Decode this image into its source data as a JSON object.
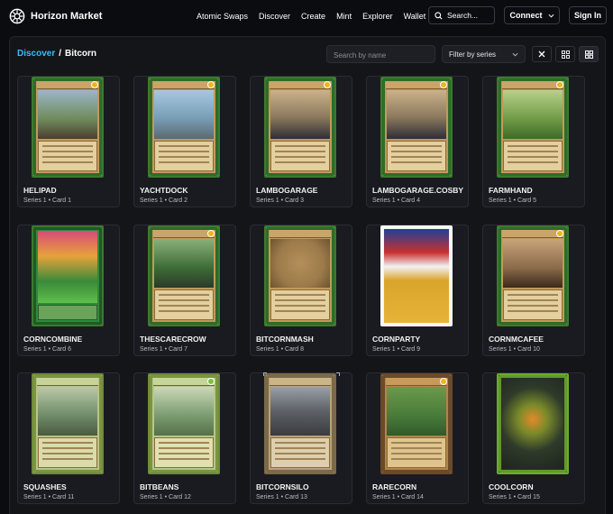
{
  "app": {
    "name": "Horizon Market"
  },
  "nav": {
    "items": [
      "Atomic Swaps",
      "Discover",
      "Create",
      "Mint",
      "Explorer",
      "Wallet"
    ]
  },
  "header": {
    "search_placeholder": "Search...",
    "connect_label": "Connect",
    "signin_label": "Sign In"
  },
  "breadcrumb": {
    "root": "Discover",
    "separator": "/",
    "current": "Bitcorn"
  },
  "filters": {
    "name_placeholder": "Search by name",
    "series_label": "Filter by series"
  },
  "icons": {
    "logo": "horizon-logo-icon",
    "search": "search-icon",
    "chevron": "chevron-down-icon",
    "clear": "close-icon",
    "grid_small": "small-grid-icon",
    "grid_large": "large-grid-icon"
  },
  "colors": {
    "accent": "#38bdf8",
    "background": "#0b0c10",
    "panel": "#141519",
    "card_border_green": "#3b7a2f"
  },
  "cards": [
    {
      "name": "HELIPAD",
      "subtitle": "Series 1 • Card 1",
      "art": "#6f8a5a"
    },
    {
      "name": "YACHTDOCK",
      "subtitle": "Series 1 • Card 2",
      "art": "#7aa0b8"
    },
    {
      "name": "LAMBOGARAGE",
      "subtitle": "Series 1 • Card 3",
      "art": "#8c7a5e"
    },
    {
      "name": "LAMBOGARAGE.COSBY",
      "subtitle": "Series 1 • Card 4",
      "art": "#8c7a5e"
    },
    {
      "name": "FARMHAND",
      "subtitle": "Series 1 • Card 5",
      "art": "#6f9a45"
    },
    {
      "name": "CORNCOMBINE",
      "subtitle": "Series 1 • Card 6",
      "art": "#3a8a3a"
    },
    {
      "name": "THESCARECROW",
      "subtitle": "Series 1 • Card 7",
      "art": "#3d6b36"
    },
    {
      "name": "BITCORNMASH",
      "subtitle": "Series 1 • Card 8",
      "art": "#9c7a4a"
    },
    {
      "name": "CORNPARTY",
      "subtitle": "Series 1 • Card 9",
      "art": "#d9a42a"
    },
    {
      "name": "CORNMCAFEE",
      "subtitle": "Series 1 • Card 10",
      "art": "#8a6a4a"
    },
    {
      "name": "SQUASHES",
      "subtitle": "Series 1 • Card 11",
      "art": "#6e8a68"
    },
    {
      "name": "BITBEANS",
      "subtitle": "Series 1 • Card 12",
      "art": "#7a9a70"
    },
    {
      "name": "BITCORNSILO",
      "subtitle": "Series 1 • Card 13",
      "art": "#5d6066"
    },
    {
      "name": "RARECORN",
      "subtitle": "Series 1 • Card 14",
      "art": "#4a7a3a"
    },
    {
      "name": "COOLCORN",
      "subtitle": "Series 1 • Card 15",
      "art": "#2e3a2a"
    }
  ]
}
